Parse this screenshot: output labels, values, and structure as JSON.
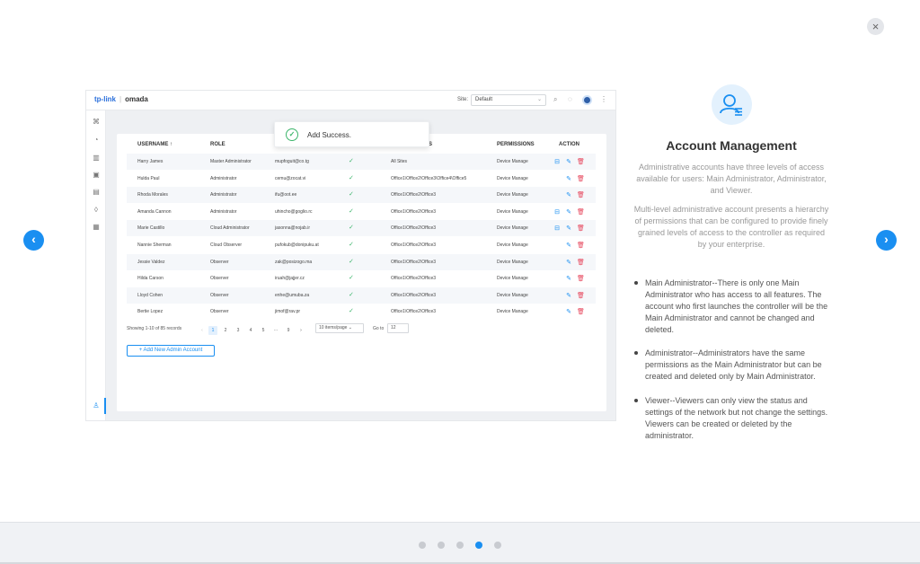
{
  "modal": {
    "close_label": "×",
    "prev_label": "‹",
    "next_label": "›"
  },
  "preview": {
    "logo_tp": "tp-link",
    "logo_sep": "|",
    "logo_product": "omada",
    "site_label": "Site:",
    "site_value": "Default",
    "headers": {
      "username": "USERNAME ↑",
      "role": "ROLE",
      "sites": "S",
      "permissions": "PERMISSIONS",
      "action": "ACTION"
    },
    "rows": [
      {
        "username": "Harry James",
        "role": "Master Administrator",
        "email": "mupfoguit@co.tg",
        "sites": "All Sites",
        "permission": "Device Manage",
        "extra": true
      },
      {
        "username": "Hulda Paul",
        "role": "Administrator",
        "email": "cemu@zocat.vi",
        "sites": "Office1\\Office2\\Office3\\Office4\\Office5",
        "permission": "Device Manage",
        "extra": false
      },
      {
        "username": "Rhoda Morales",
        "role": "Administrator",
        "email": "ifu@oot.ee",
        "sites": "Office1\\Office2\\Office3",
        "permission": "Device Manage",
        "extra": false
      },
      {
        "username": "Amanda Cannon",
        "role": "Administrator",
        "email": "uhincho@goglio.rc",
        "sites": "Office1\\Office2\\Office3",
        "permission": "Device Manage",
        "extra": true
      },
      {
        "username": "Marie Castillo",
        "role": "Cloud Administrator",
        "email": "jasonna@nojab.ir",
        "sites": "Office1\\Office2\\Office3",
        "permission": "Device Manage",
        "extra": true
      },
      {
        "username": "Nannie Sherman",
        "role": "Cloud Observer",
        "email": "pufokub@donipuku.at",
        "sites": "Office1\\Office2\\Office3",
        "permission": "Device Manage",
        "extra": false
      },
      {
        "username": "Jessie Valdez",
        "role": "Observer",
        "email": "zak@posizogo.ma",
        "sites": "Office1\\Office2\\Office3",
        "permission": "Device Manage",
        "extra": false
      },
      {
        "username": "Hilda Carson",
        "role": "Observer",
        "email": "iruah@jajjer.cz",
        "sites": "Office1\\Office2\\Office3",
        "permission": "Device Manage",
        "extra": false
      },
      {
        "username": "Lloyd Cohen",
        "role": "Observer",
        "email": "enhe@umuba.za",
        "sites": "Office1\\Office2\\Office3",
        "permission": "Device Manage",
        "extra": false
      },
      {
        "username": "Bertie Lopez",
        "role": "Observer",
        "email": "jimof@rav.pr",
        "sites": "Office1\\Office2\\Office3",
        "permission": "Device Manage",
        "extra": false
      }
    ],
    "check_mark": "✓",
    "pager": {
      "records": "Showing 1-10 of 85 records",
      "pages": [
        "1",
        "2",
        "3",
        "4",
        "5",
        "···",
        "9"
      ],
      "prev": "‹",
      "next": "›",
      "per_page": "10 items/page",
      "goto_label": "Go to",
      "goto_value": "12"
    },
    "add_button": "+ Add New Admin Account",
    "toast": "Add Success.",
    "toast_icon": "✓"
  },
  "content": {
    "title": "Account Management",
    "desc1": "Administrative accounts have three levels of access available for users: Main Administrator, Administrator, and Viewer.",
    "desc2": "Multi-level administrative account presents a hierarchy of permissions that can be configured to provide finely grained levels of access to the controller as required by your enterprise.",
    "bullets": [
      "Main Administrator--There is only one Main Administrator who has access to all features. The account who first launches the controller will be the Main Administrator and cannot be changed and deleted.",
      "Administrator--Administrators have the same permissions as the Main Administrator but can be created and deleted only by Main Administrator.",
      "Viewer--Viewers can only view the status and settings of the network but not change the settings. Viewers can be created or deleted by the administrator."
    ]
  },
  "pagination": {
    "count": 5,
    "active_index": 3
  },
  "colors": {
    "accent": "#1a8ff1",
    "success": "#3cb56b",
    "danger": "#e6455b"
  }
}
